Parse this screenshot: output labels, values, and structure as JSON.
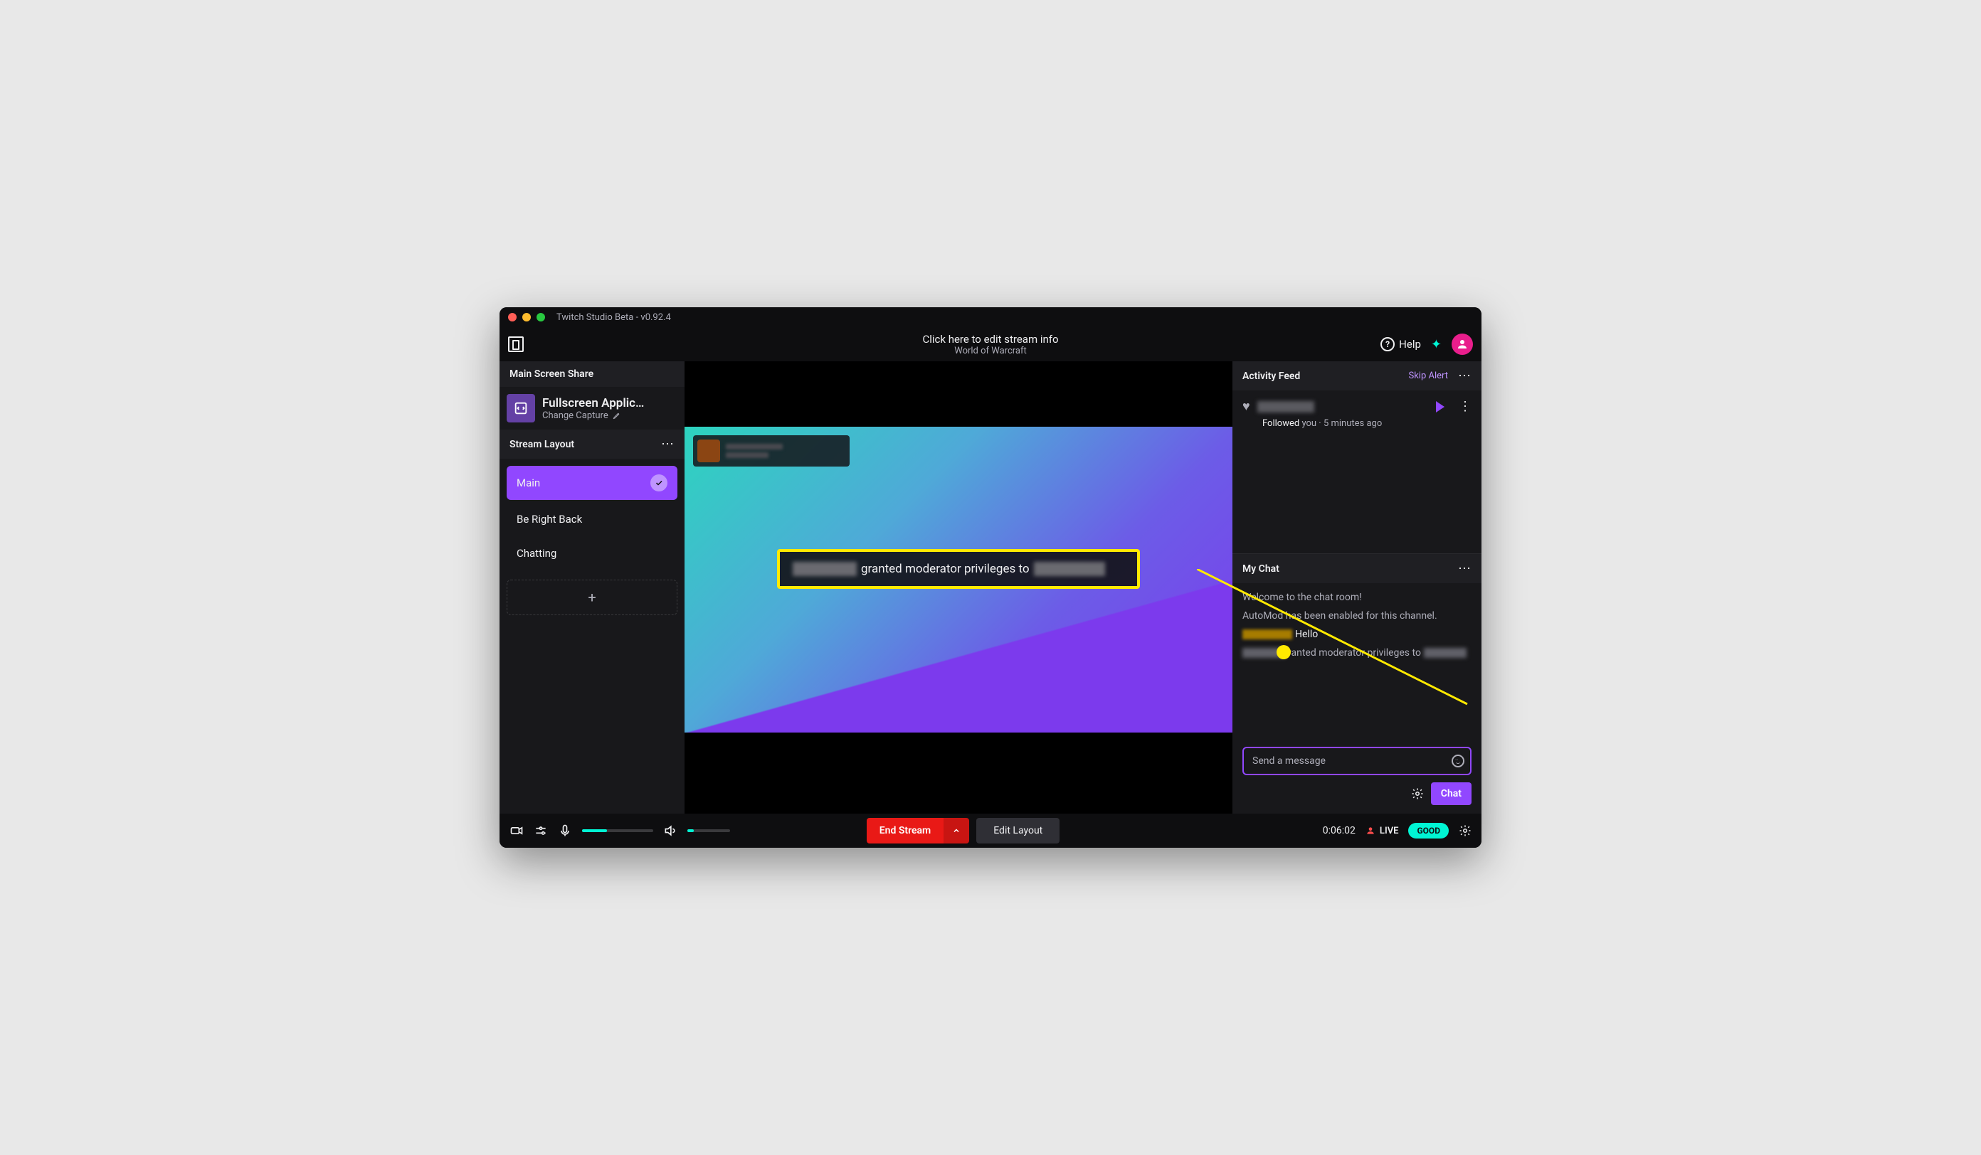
{
  "window": {
    "title": "Twitch Studio Beta - v0.92.4"
  },
  "header": {
    "title": "Click here to edit stream info",
    "subtitle": "World of Warcraft",
    "help_label": "Help"
  },
  "left": {
    "share_header": "Main Screen Share",
    "capture_title": "Fullscreen Applic…",
    "capture_sub": "Change Capture",
    "layout_header": "Stream Layout",
    "scenes": [
      {
        "label": "Main",
        "active": true
      },
      {
        "label": "Be Right Back",
        "active": false
      },
      {
        "label": "Chatting",
        "active": false
      }
    ]
  },
  "callout": {
    "text": "granted moderator privileges to"
  },
  "activity": {
    "header": "Activity Feed",
    "skip_label": "Skip Alert",
    "followed_label": "Followed",
    "you_label": "you",
    "time_label": "5 minutes ago"
  },
  "chat": {
    "header": "My Chat",
    "welcome": "Welcome to the chat room!",
    "automod": "AutoMod has been enabled for this channel.",
    "hello_msg": "Hello",
    "mod_msg_part": "ranted moderator privileges to",
    "input_placeholder": "Send a message",
    "chat_button": "Chat"
  },
  "bottom": {
    "mic_level": 35,
    "speaker_level": 15,
    "end_stream": "End Stream",
    "edit_layout": "Edit Layout",
    "timer": "0:06:02",
    "live_label": "LIVE",
    "quality": "GOOD"
  }
}
